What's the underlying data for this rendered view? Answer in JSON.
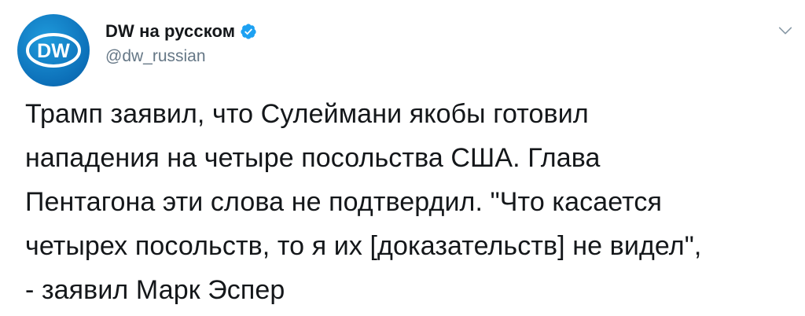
{
  "account": {
    "display_name": "DW на русском",
    "handle": "@dw_russian",
    "verified": true,
    "avatar_text": "DW"
  },
  "tweet": {
    "text": "Трамп заявил, что Сулеймани якобы готовил\nнападения на четыре посольства США. Глава\nПентагона эти слова не подтвердил. \"Что касается\nчетырех посольств, то я их [доказательств] не видел\",\n- заявил Марк Эспер"
  },
  "colors": {
    "text_primary": "#14171a",
    "text_secondary": "#657786",
    "verified_blue": "#1da1f2",
    "avatar_blue": "#0c6fb8"
  },
  "icons": {
    "verified": "verified-badge-icon",
    "menu": "chevron-down-icon"
  }
}
